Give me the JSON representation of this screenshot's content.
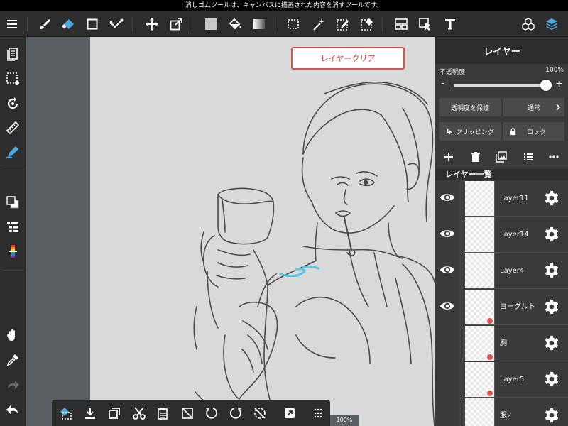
{
  "status_bar": {
    "message": "消しゴムツールは、キャンバスに描画された内容を消すツールです。"
  },
  "toolbar": {
    "tools": [
      "menu-icon",
      "brush-icon",
      "eraser-icon",
      "shape-icon",
      "dot-line-icon",
      "move-icon",
      "transform-icon",
      "fill-color-icon",
      "bucket-icon",
      "gradient-icon",
      "select-rect-icon",
      "magic-wand-icon",
      "select-pen-icon",
      "select-eraser-icon",
      "layout-icon",
      "select-arrow-icon",
      "text-icon",
      "materials-icon",
      "layers-icon"
    ]
  },
  "left_tools": [
    "pages-icon",
    "selection-icon",
    "rotate-view-icon",
    "ruler-icon",
    "pen-icon",
    "color-icon",
    "palette-list-icon",
    "color-bar-icon",
    "hand-icon",
    "eyedropper-icon",
    "redo-icon",
    "undo-icon"
  ],
  "canvas": {
    "clear_button_label": "レイヤークリア",
    "zoom_text": "100%"
  },
  "bottom_bar": {
    "tools": [
      "deselect-icon",
      "import-icon",
      "duplicate-icon",
      "cut-icon",
      "paste-icon",
      "clear-icon",
      "rotate-left-icon",
      "rotate-right-icon",
      "flip-icon",
      "expand-icon",
      "grid-icon"
    ]
  },
  "layer_panel": {
    "title": "レイヤー",
    "opacity_label": "不透明度",
    "opacity_value": "100%",
    "opacity_fraction": 1.0,
    "protect_alpha_label": "透明度を保護",
    "blend_mode_label": "通常",
    "clipping_label": "クリッピング",
    "lock_label": "ロック",
    "list_header": "レイヤー一覧",
    "layers": [
      {
        "name": "Layer11",
        "visible": true,
        "clipped": false
      },
      {
        "name": "Layer14",
        "visible": true,
        "clipped": false
      },
      {
        "name": "Layer4",
        "visible": true,
        "clipped": false
      },
      {
        "name": "ヨーグルト",
        "visible": true,
        "clipped": true
      },
      {
        "name": "胸",
        "visible": false,
        "clipped": true
      },
      {
        "name": "Layer5",
        "visible": false,
        "clipped": true
      },
      {
        "name": "服2",
        "visible": false,
        "clipped": false
      }
    ]
  },
  "colors": {
    "accent": "#d9544f",
    "active_tool": "#4ea7e0",
    "toolbar_bg": "#2d2d2d",
    "canvas_bg": "#d9d9d9"
  }
}
